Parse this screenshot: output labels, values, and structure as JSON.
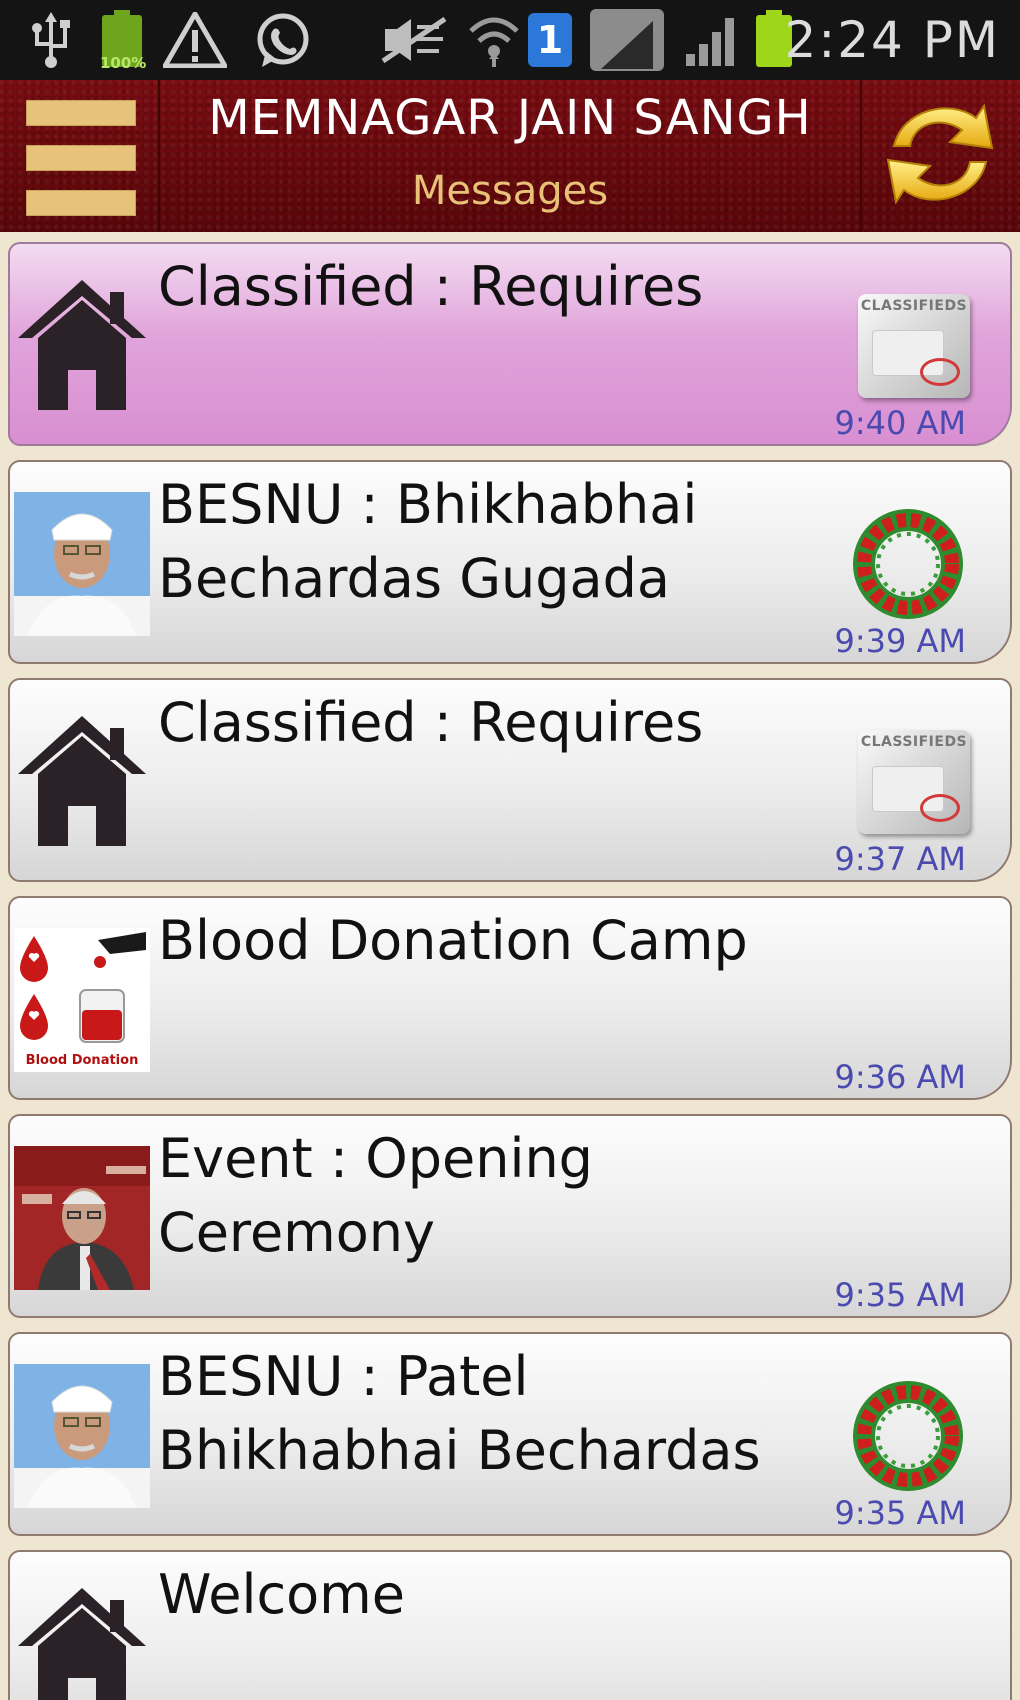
{
  "status_bar": {
    "time": "2:24 PM",
    "battery_left_percent": "100%",
    "notification_count": "1",
    "icons": [
      "usb-icon",
      "battery-icon",
      "warning-icon",
      "whatsapp-icon",
      "mute-icon",
      "wifi-icon",
      "notification-badge-icon",
      "signal-icon",
      "signal-icon",
      "battery-icon"
    ]
  },
  "app_bar": {
    "title": "MEMNAGAR JAIN SANGH",
    "subtitle": "Messages",
    "menu_icon": "menu-icon",
    "refresh_icon": "refresh-icon"
  },
  "messages": [
    {
      "title": "Classified : Requires",
      "time": "9:40 AM",
      "thumb": "house-icon",
      "badge": "classifieds-icon",
      "badge_label": "CLASSIFIEDS",
      "highlighted": true
    },
    {
      "title": "BESNU : Bhikhabhai Bechardas Gugada",
      "time": "9:39 AM",
      "thumb": "person-photo",
      "badge": "wreath-icon",
      "highlighted": false
    },
    {
      "title": "Classified : Requires",
      "time": "9:37 AM",
      "thumb": "house-icon",
      "badge": "classifieds-icon",
      "badge_label": "CLASSIFIEDS",
      "highlighted": false
    },
    {
      "title": "Blood Donation Camp",
      "time": "9:36 AM",
      "thumb": "blood-donation-image",
      "thumb_caption": "Blood Donation",
      "badge": null,
      "highlighted": false
    },
    {
      "title": "Event : Opening Ceremony",
      "time": "9:35 AM",
      "thumb": "event-photo",
      "badge": null,
      "highlighted": false
    },
    {
      "title": "BESNU : Patel Bhikhabhai Bechardas",
      "time": "9:35 AM",
      "thumb": "person-photo",
      "badge": "wreath-icon",
      "highlighted": false
    },
    {
      "title": "Welcome",
      "time": "",
      "thumb": "house-icon",
      "badge": null,
      "highlighted": false
    }
  ],
  "colors": {
    "header_bg": "#6a0a0f",
    "menu_bars": "#e6c27a",
    "subtitle": "#e8c277",
    "highlight_card": "#d88fd1",
    "time_text": "#4b4ab0",
    "refresh_arrows": "#f2c21a"
  }
}
